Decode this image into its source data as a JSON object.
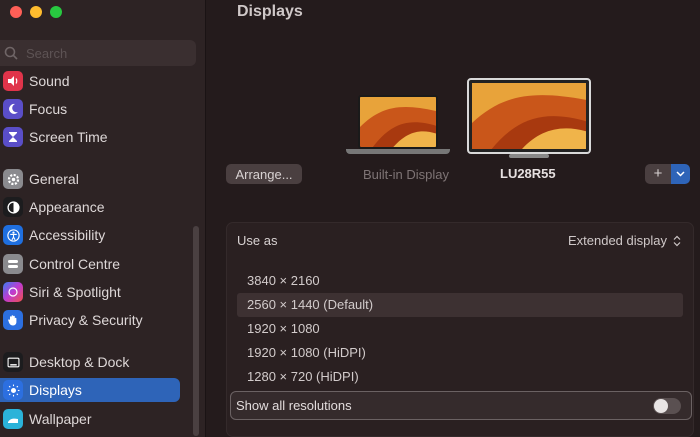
{
  "sidebar": {
    "search": {
      "placeholder": "Search"
    },
    "items": [
      {
        "label": "Sound",
        "icon": "sound-icon",
        "color": "#e0344a"
      },
      {
        "label": "Focus",
        "icon": "moon-icon",
        "color": "#5a4ec8"
      },
      {
        "label": "Screen Time",
        "icon": "hourglass-icon",
        "color": "#5a4ec8"
      },
      {
        "label": "General",
        "icon": "gear-icon",
        "color": "#8a8a8e"
      },
      {
        "label": "Appearance",
        "icon": "appearance-icon",
        "color": "#1c1c1e"
      },
      {
        "label": "Accessibility",
        "icon": "accessibility-icon",
        "color": "#1f6fe0"
      },
      {
        "label": "Control Centre",
        "icon": "control-centre-icon",
        "color": "#8a8a8e"
      },
      {
        "label": "Siri & Spotlight",
        "icon": "siri-icon",
        "color": "#8e3fc9"
      },
      {
        "label": "Privacy & Security",
        "icon": "hand-icon",
        "color": "#2c6fe0"
      },
      {
        "label": "Desktop & Dock",
        "icon": "dock-icon",
        "color": "#1c1c1e"
      },
      {
        "label": "Displays",
        "icon": "sun-icon",
        "color": "#2c6fe0",
        "active": true
      },
      {
        "label": "Wallpaper",
        "icon": "wallpaper-icon",
        "color": "#2bb3d9"
      }
    ]
  },
  "main": {
    "title": "Displays",
    "arrange_label": "Arrange...",
    "display_builtin": "Built-in Display",
    "display_external": "LU28R55",
    "add_label": "+",
    "use_as": {
      "label": "Use as",
      "value": "Extended display"
    },
    "resolutions": [
      {
        "label": "3840 × 2160",
        "selected": false
      },
      {
        "label": "2560 × 1440 (Default)",
        "selected": true
      },
      {
        "label": "1920 × 1080",
        "selected": false
      },
      {
        "label": "1920 × 1080 (HiDPI)",
        "selected": false
      },
      {
        "label": "1280 × 720 (HiDPI)",
        "selected": false
      }
    ],
    "show_all": {
      "label": "Show all resolutions",
      "on": false
    }
  },
  "colors": {
    "accent": "#2e64b8",
    "background": "#241b1c",
    "sidebar": "#2d2324"
  }
}
